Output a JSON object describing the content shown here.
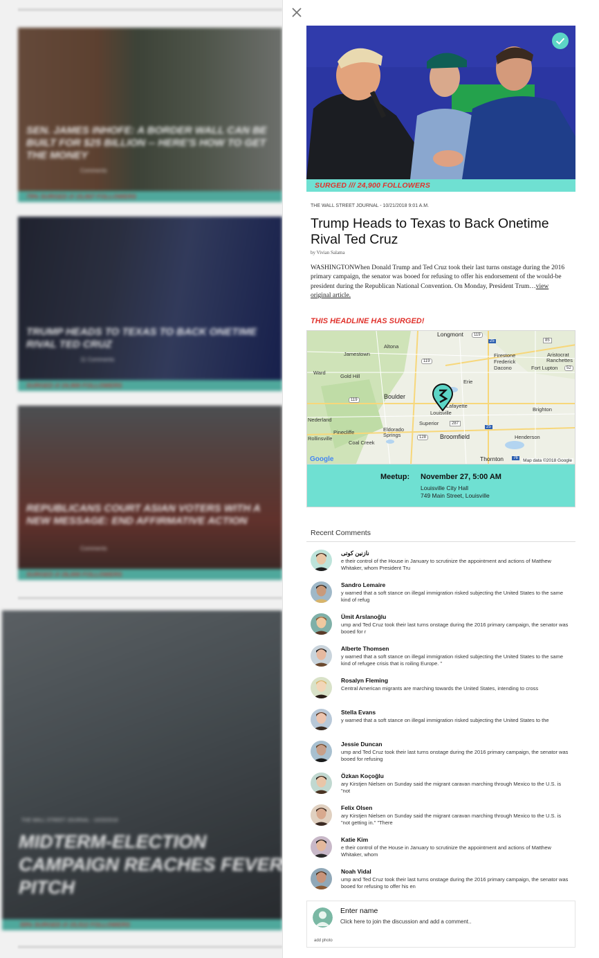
{
  "background_feed": {
    "cards": [
      {
        "title": "Sen. James Inhofe: A Border Wall Can Be Built for $25 Billion -- Here's How to Get the Money",
        "meta": "Comments",
        "bar": "79% SURGED /// 15,567 FOLLOWERS"
      },
      {
        "title": "Trump Heads to Texas to Back Onetime Rival Ted Cruz",
        "meta": "11 Comments",
        "bar": "SURGED /// 24,900 FOLLOWERS"
      },
      {
        "title": "Republicans Court Asian Voters With a New Message: End Affirmative Action",
        "meta": "Comments",
        "bar": "SURGED /// 26,000 FOLLOWERS"
      }
    ],
    "big_card": {
      "source": "THE WALL STREET JOURNAL - 10/20/2018",
      "title": "Midterm-Election Campaign Reaches Fever Pitch",
      "bar": "59% SURGED /// 15,512 FOLLOWERS"
    }
  },
  "detail": {
    "close_label": "Close",
    "hero_bar": "SURGED /// 24,900 FOLLOWERS",
    "source_line": "THE WALL STREET JOURNAL - 10/21/2018 9:01 A.M.",
    "title": "Trump Heads to Texas to Back Onetime Rival Ted Cruz",
    "byline": "by Vivian Salama",
    "body": "WASHINGTONWhen Donald Trump and Ted Cruz took their last turns onstage during the 2016 primary campaign, the senator was booed for refusing to offer his endorsement of the would-be president during the Republican National Convention. On Monday, President Trum…",
    "view_link": "view original article.",
    "surged_alert": "THIS HEADLINE HAS SURGED!",
    "map": {
      "labels": {
        "longmont": "Longmont",
        "altona": "Altona",
        "jamestown": "Jamestown",
        "firestone": "Firestone",
        "frederick": "Frederick",
        "dacono": "Dacono",
        "fort_lupton": "Fort Lupton",
        "aristocrat": "Aristocrat",
        "ranchettes": "Ranchettes",
        "ward": "Ward",
        "gold_hill": "Gold Hill",
        "erie": "Erie",
        "boulder": "Boulder",
        "lafayette": "Lafayette",
        "louisville": "Louisville",
        "superior": "Superior",
        "brighton": "Brighton",
        "nederland": "Nederland",
        "pinecliffe": "Pinecliffe",
        "eldorado_springs": "Eldorado Springs",
        "rollinsville": "Rollinsville",
        "coal_creek": "Coal Creek",
        "broomfield": "Broomfield",
        "henderson": "Henderson",
        "thornton": "Thornton"
      },
      "shields": {
        "r119a": "119",
        "r25a": "25",
        "r85": "85",
        "r119b": "119",
        "r52": "52",
        "r119c": "119",
        "r287": "287",
        "r128": "128",
        "r25b": "25",
        "r76": "76"
      },
      "logo": "Google",
      "attribution": "Map data ©2018 Google"
    },
    "meetup": {
      "label": "Meetup:",
      "date": "November 27, 5:00 AM",
      "venue": "Louisville City Hall",
      "address": "749 Main Street, Louisville"
    },
    "comments_heading": "Recent Comments",
    "comments": [
      {
        "name": "نازنین کوتی",
        "text": "e their control of the House in January to scrutinize the appointment and actions of Matthew Whitaker, whom President Tru"
      },
      {
        "name": "Sandro Lemaire",
        "text": "y warned that a soft stance on illegal immigration risked subjecting the United States to the same kind of refug"
      },
      {
        "name": "Ümit Arslanoğlu",
        "text": "ump and Ted Cruz took their last turns onstage during the 2016 primary campaign, the senator was booed for r"
      },
      {
        "name": "Alberte Thomsen",
        "text": "y warned that a soft stance on illegal immigration risked subjecting the United States to the same kind of refugee crisis that is roiling Europe. \""
      },
      {
        "name": "Rosalyn Fleming",
        "text": "Central American migrants are marching towards the United States, intending to cross"
      },
      {
        "name": "Stella Evans",
        "text": "y warned that a soft stance on illegal immigration risked subjecting the United States to the"
      },
      {
        "name": "Jessie Duncan",
        "text": "ump and Ted Cruz took their last turns onstage during the 2016 primary campaign, the senator was booed for refusing"
      },
      {
        "name": "Özkan Koçoğlu",
        "text": "ary Kirstjen Nielsen on Sunday said the migrant caravan marching through Mexico to the U.S. is \"not"
      },
      {
        "name": "Felix Olsen",
        "text": "ary Kirstjen Nielsen on Sunday said the migrant caravan marching through Mexico to the U.S. is \"not getting in.\" \"There"
      },
      {
        "name": "Katie Kim",
        "text": "e their control of the House in January to scrutinize the appointment and actions of Matthew Whitaker, whom"
      },
      {
        "name": "Noah Vidal",
        "text": "ump and Ted Cruz took their last turns onstage during the 2016 primary campaign, the senator was booed for refusing to offer his en"
      }
    ],
    "composer": {
      "name_placeholder": "Enter name",
      "comment_placeholder": "Click here to join the discussion and add a comment..",
      "add_photo": "add photo"
    },
    "colors": {
      "accent": "#6fe0d2",
      "alert": "#e0322c",
      "badge": "#5cd5c6"
    }
  }
}
